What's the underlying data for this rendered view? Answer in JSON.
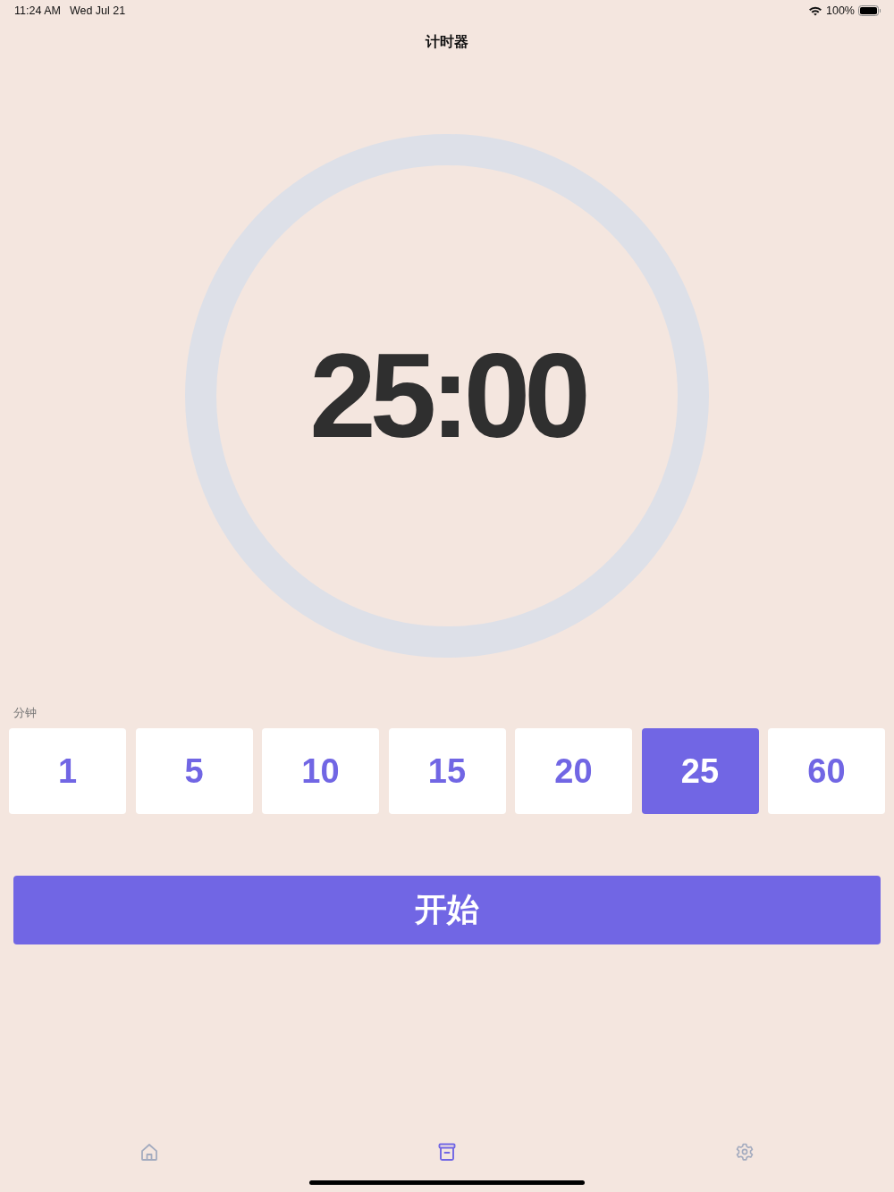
{
  "status_bar": {
    "time": "11:24 AM",
    "date": "Wed Jul 21",
    "battery": "100%"
  },
  "nav": {
    "title": "计时器"
  },
  "timer": {
    "display": "25:00"
  },
  "minutes": {
    "label": "分钟",
    "options": [
      {
        "label": "1",
        "selected": false
      },
      {
        "label": "5",
        "selected": false
      },
      {
        "label": "10",
        "selected": false
      },
      {
        "label": "15",
        "selected": false
      },
      {
        "label": "20",
        "selected": false
      },
      {
        "label": "25",
        "selected": true
      },
      {
        "label": "60",
        "selected": false
      }
    ]
  },
  "start_button": {
    "label": "开始"
  },
  "tab_bar": {
    "items": [
      {
        "kind": "home",
        "selected": false
      },
      {
        "kind": "archive",
        "selected": true
      },
      {
        "kind": "settings",
        "selected": false
      }
    ]
  }
}
